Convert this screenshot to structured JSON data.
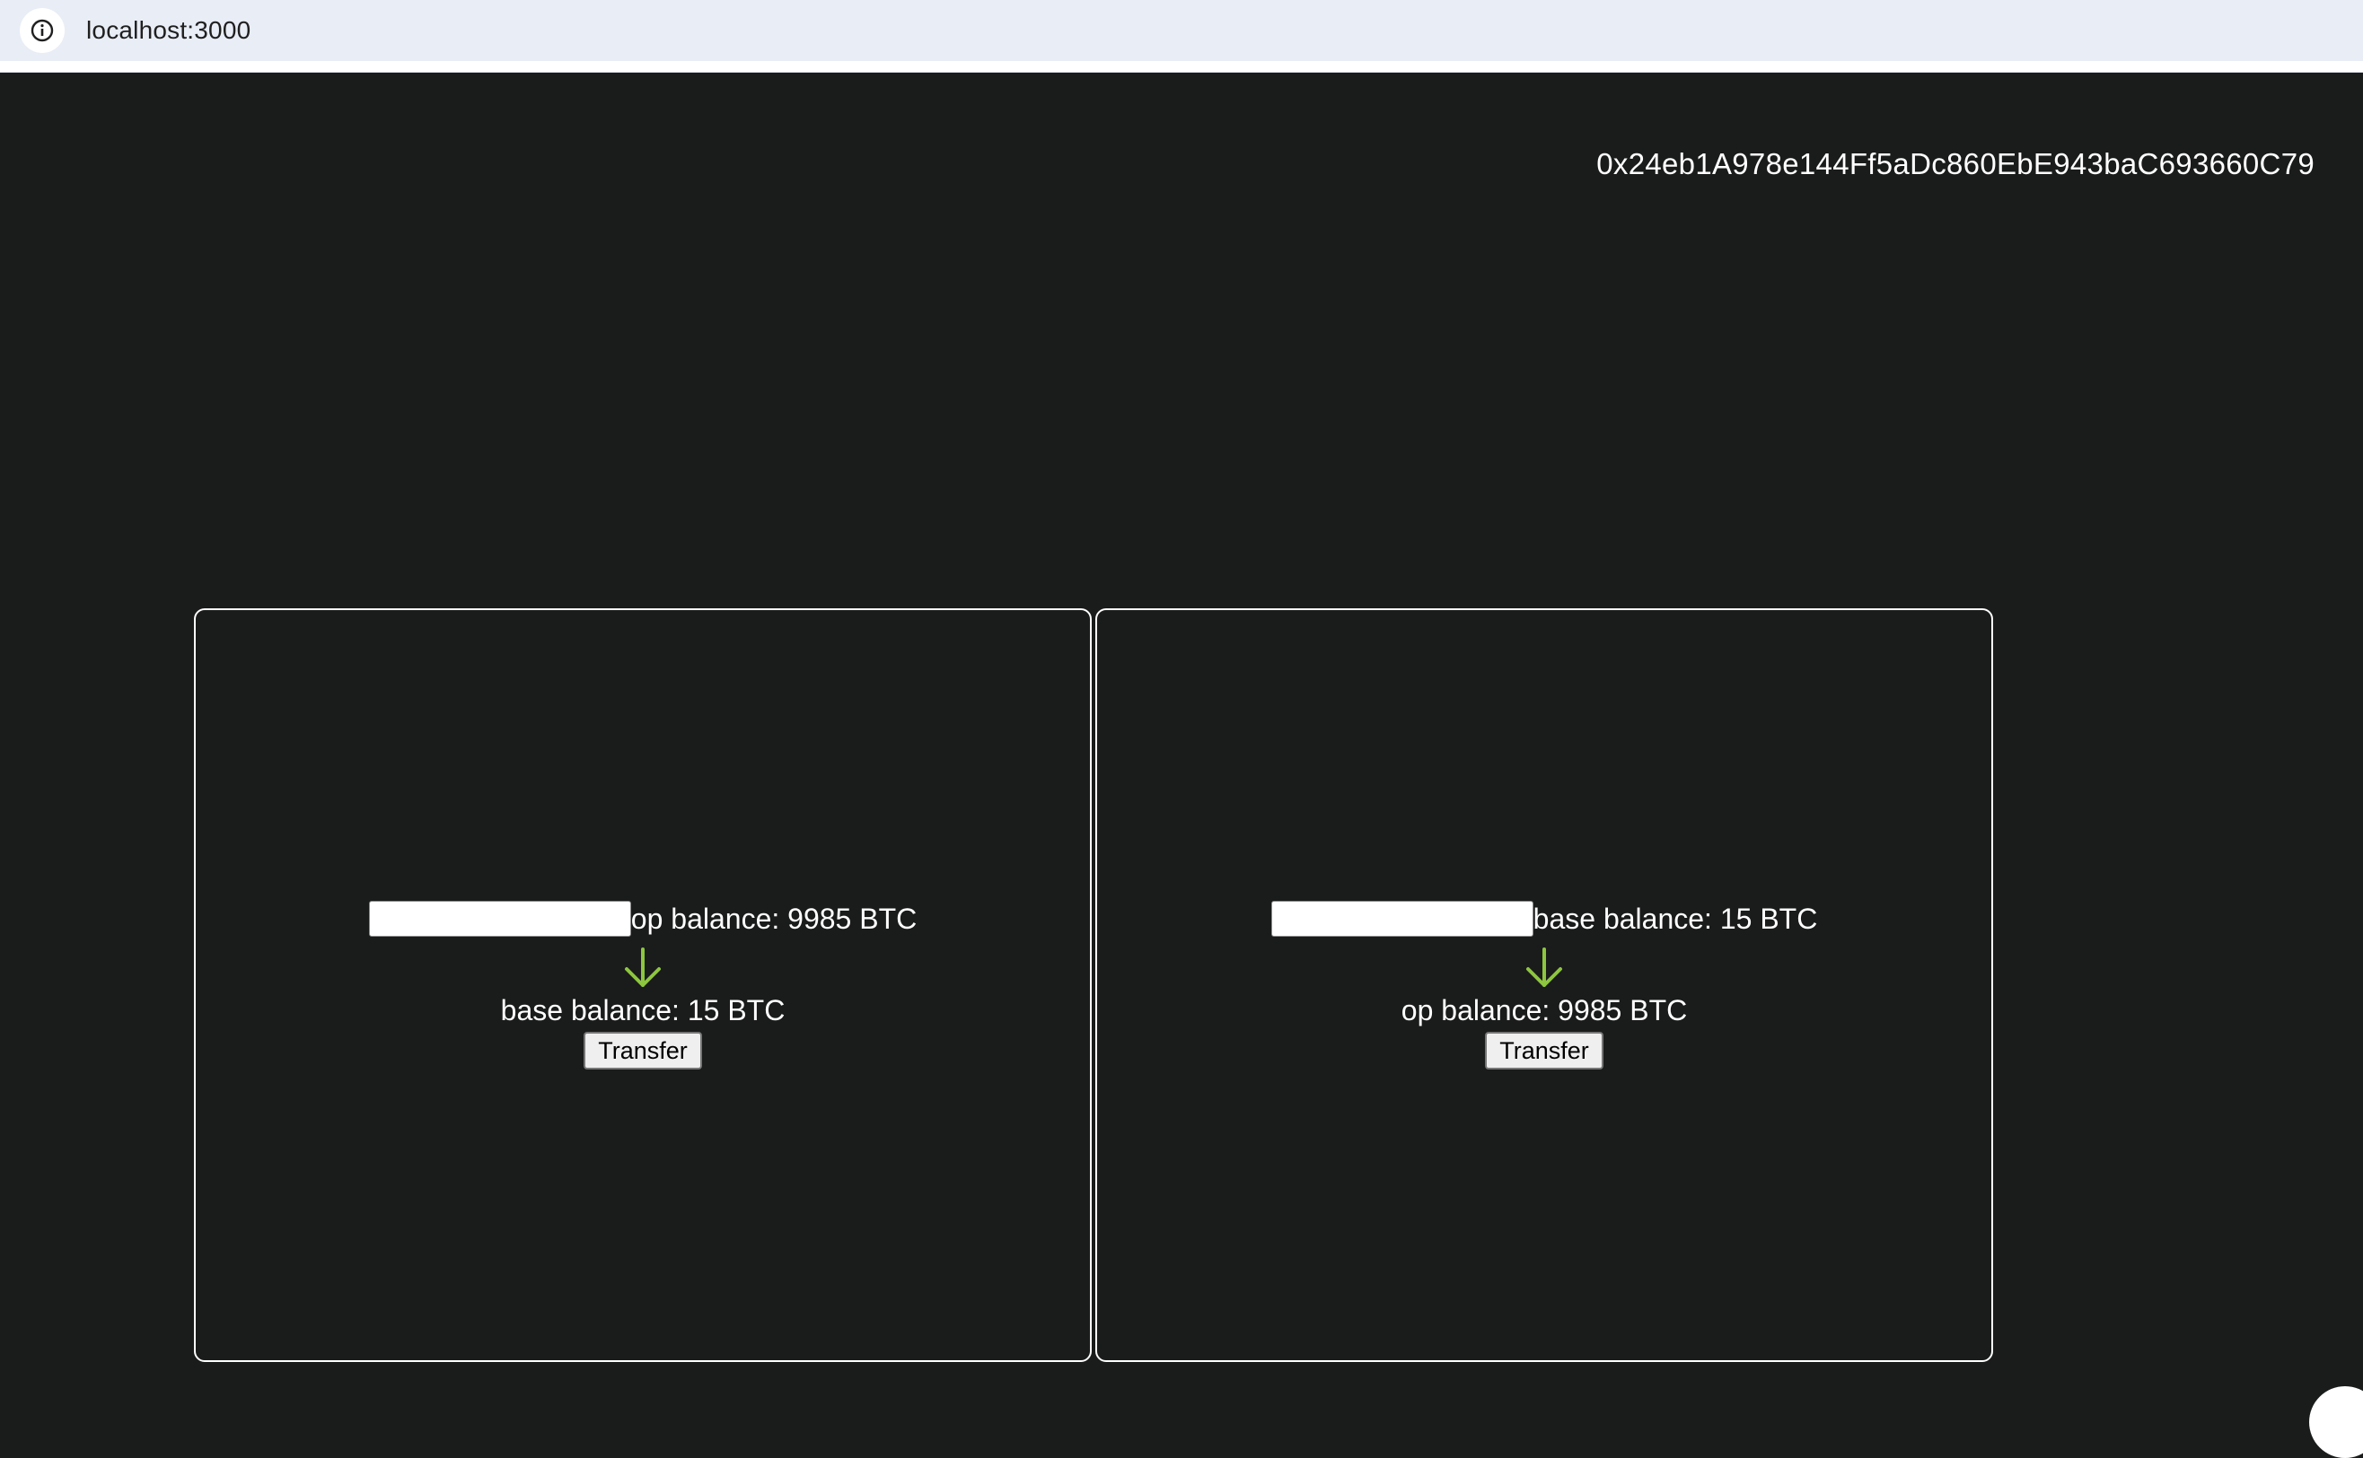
{
  "browser": {
    "url": "localhost:3000",
    "icon": "info-icon"
  },
  "header": {
    "wallet_address": "0x24eb1A978e144Ff5aDc860EbE943baC693660C79"
  },
  "panels": [
    {
      "amount_value": "",
      "source_balance": "op balance: 9985 BTC",
      "destination_balance": "base balance: 15 BTC",
      "transfer_label": "Transfer",
      "arrow_icon": "arrow-down-icon"
    },
    {
      "amount_value": "",
      "source_balance": "base balance: 15 BTC",
      "destination_balance": "op balance: 9985 BTC",
      "transfer_label": "Transfer",
      "arrow_icon": "arrow-down-icon"
    }
  ],
  "colors": {
    "background": "#1a1b1b",
    "arrow": "#8dc63f",
    "text": "#ffffff",
    "address_bar": "#e8edf6"
  }
}
